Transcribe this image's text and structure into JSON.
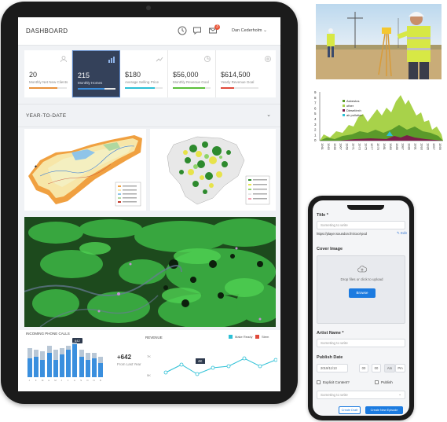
{
  "dashboard": {
    "title": "DASHBOARD",
    "user_name": "Dan Cederholm",
    "notification_count": "3",
    "cards": [
      {
        "value": "20",
        "label": "Monthly Net New Clients",
        "color": "#e8913b",
        "progress": 0.75
      },
      {
        "value": "215",
        "label": "Monthly Homes",
        "color": "#3a8fde",
        "progress": 0.7
      },
      {
        "value": "$180",
        "label": "Average Selling Price",
        "color": "#2cc0d6",
        "progress": 0.8
      },
      {
        "value": "$56,000",
        "label": "Monthly Revenue Goal",
        "color": "#5cbf3b",
        "progress": 0.85
      },
      {
        "value": "$614,500",
        "label": "Yearly Revenue Goal",
        "color": "#e04a3b",
        "progress": 0.35
      }
    ],
    "section_title": "YEAR-TO-DATE",
    "calls": {
      "title": "INCOMING PHONE CALLS",
      "tooltip": "642",
      "big_value": "+642",
      "sub_label": "From Last Year",
      "month_letters": [
        "J",
        "F",
        "M",
        "A",
        "M",
        "J",
        "J",
        "A",
        "S",
        "O",
        "N",
        "D"
      ],
      "values": [
        0.55,
        0.6,
        0.5,
        0.7,
        0.5,
        0.65,
        0.8,
        0.95,
        0.6,
        0.5,
        0.55,
        0.4
      ],
      "totals": [
        0.85,
        0.8,
        0.75,
        0.9,
        0.8,
        0.85,
        0.9,
        1.0,
        0.8,
        0.7,
        0.7,
        0.6
      ]
    },
    "revenue": {
      "title": "REVENUE",
      "legend": [
        "Make Ready",
        "Stem"
      ],
      "legend_colors": [
        "#2cc0d6",
        "#e04a3b"
      ],
      "tooltip": "4K",
      "y_labels": [
        "7K",
        "5K"
      ]
    }
  },
  "area_chart": {
    "chart_data": {
      "type": "area",
      "legend": [
        "Asbestos",
        "other",
        "Diesel/exh",
        "air pollution"
      ],
      "y_ticks": [
        "9",
        "8",
        "7",
        "6",
        "5",
        "4",
        "3",
        "2",
        "1",
        "0"
      ],
      "x_labels": [
        "1961",
        "1963",
        "1965",
        "1967",
        "1969",
        "1971",
        "1973",
        "1975",
        "1977",
        "1979",
        "1981",
        "1983",
        "1985",
        "1987",
        "1989",
        "1991",
        "1993",
        "1995",
        "1997",
        "1999"
      ]
    }
  },
  "form": {
    "title_label": "Title *",
    "title_placeholder": "Someting to write",
    "url": "https://player.soundon.fm/cool-pod",
    "edit_label": "Edit",
    "cover_label": "Cover Image",
    "upload_text": "Drop files or click to upload",
    "browse_label": "Browse",
    "artist_label": "Artist Name *",
    "artist_placeholder": "Someting to write",
    "publish_date_label": "Publish Date",
    "date_value": "2019/11/13",
    "hour": "00",
    "minute": "00",
    "am": "Am",
    "pm": "Pm",
    "explicit_label": "Explicit Content?",
    "publish_label": "Publish",
    "select_placeholder": "Someting to write",
    "draft_button": "Create Draft",
    "create_button": "Create New Episode"
  }
}
